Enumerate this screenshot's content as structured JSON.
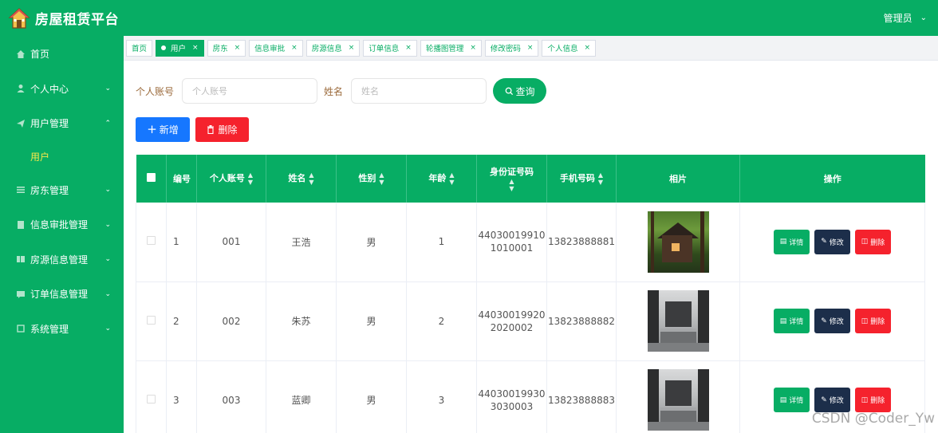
{
  "app": {
    "title": "房屋租赁平台"
  },
  "header": {
    "admin_label": "管理员"
  },
  "sidebar": {
    "items": [
      {
        "label": "首页",
        "icon": "home-icon"
      },
      {
        "label": "个人中心",
        "icon": "user-icon"
      },
      {
        "label": "用户管理",
        "icon": "send-icon"
      },
      {
        "label": "房东管理",
        "icon": "list-icon"
      },
      {
        "label": "信息审批管理",
        "icon": "file-icon"
      },
      {
        "label": "房源信息管理",
        "icon": "grid-icon"
      },
      {
        "label": "订单信息管理",
        "icon": "chat-icon"
      },
      {
        "label": "系统管理",
        "icon": "crop-icon"
      }
    ],
    "sub_active": "用户"
  },
  "tabs": [
    {
      "label": "首页",
      "closable": false
    },
    {
      "label": "用户",
      "active": true
    },
    {
      "label": "房东"
    },
    {
      "label": "信息审批"
    },
    {
      "label": "房源信息"
    },
    {
      "label": "订单信息"
    },
    {
      "label": "轮播图管理"
    },
    {
      "label": "修改密码"
    },
    {
      "label": "个人信息"
    }
  ],
  "search": {
    "account_label": "个人账号",
    "account_placeholder": "个人账号",
    "name_label": "姓名",
    "name_placeholder": "姓名",
    "query_label": "查询"
  },
  "actions": {
    "add_label": "新增",
    "delete_label": "删除"
  },
  "table": {
    "headers": [
      "编号",
      "个人账号",
      "姓名",
      "性别",
      "年龄",
      "身份证号码",
      "手机号码",
      "相片",
      "操作"
    ],
    "rows": [
      {
        "no": "1",
        "account": "001",
        "name": "王浩",
        "gender": "男",
        "age": "1",
        "id_line1": "44030019910",
        "id_line2": "1010001",
        "phone": "13823888881",
        "photo": "forest-cabin"
      },
      {
        "no": "2",
        "account": "002",
        "name": "朱苏",
        "gender": "男",
        "age": "2",
        "id_line1": "44030019920",
        "id_line2": "2020002",
        "phone": "13823888882",
        "photo": "bedroom"
      },
      {
        "no": "3",
        "account": "003",
        "name": "蓝卿",
        "gender": "男",
        "age": "3",
        "id_line1": "44030019930",
        "id_line2": "3030003",
        "phone": "13823888883",
        "photo": "bedroom"
      }
    ],
    "op_detail": "详情",
    "op_edit": "修改",
    "op_delete": "删除"
  },
  "watermark": "CSDN @Coder_Yw",
  "colors": {
    "primary": "#07ad64",
    "blue": "#1677ff",
    "red": "#f5222d",
    "navy": "#1c2e4a",
    "highlight": "#f7e84a"
  }
}
